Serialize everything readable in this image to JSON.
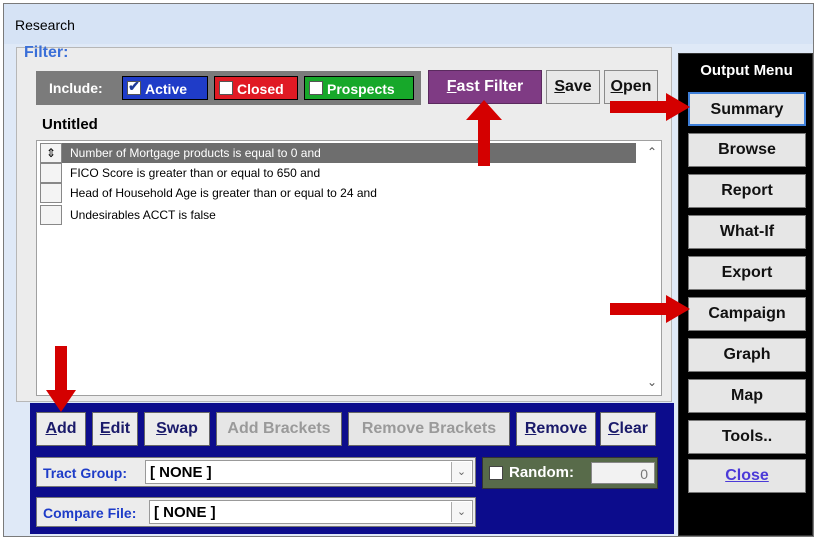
{
  "window": {
    "title": "Research"
  },
  "filter": {
    "label": "Filter:",
    "include_label": "Include:",
    "include_options": [
      {
        "label": "Active",
        "checked": true,
        "color": "#1f3cc8"
      },
      {
        "label": "Closed",
        "checked": false,
        "color": "#e01a24"
      },
      {
        "label": "Prospects",
        "checked": false,
        "color": "#17a82a"
      }
    ],
    "fast_filter_label": "Fast Filter",
    "fast_filter_hotkey": "F",
    "fast_filter_rest": "ast Filter",
    "save_hotkey": "S",
    "save_rest": "ave",
    "open_hotkey": "O",
    "open_rest": "pen",
    "name": "Untitled",
    "conditions": [
      {
        "text": "Number of Mortgage products is equal to 0 and",
        "selected": true
      },
      {
        "text": "FICO Score is greater than or equal to 650 and",
        "selected": false
      },
      {
        "text": "Head of Household Age is greater than or equal to 24 and",
        "selected": false
      },
      {
        "text": "Undesirables ACCT is false",
        "selected": false
      }
    ]
  },
  "actions": {
    "add_hotkey": "A",
    "add_rest": "dd",
    "edit_hotkey": "E",
    "edit_rest": "dit",
    "swap_hotkey": "S",
    "swap_rest": "wap",
    "add_brackets": "Add Brackets",
    "remove_brackets": "Remove Brackets",
    "remove_hotkey": "R",
    "remove_rest": "emove",
    "clear_hotkey": "C",
    "clear_rest": "lear"
  },
  "tract_group": {
    "label": "Tract Group:",
    "value": "[ NONE ]"
  },
  "compare_file": {
    "label": "Compare File:",
    "value": "[ NONE ]"
  },
  "random": {
    "label": "Random:",
    "checked": false,
    "value": "0"
  },
  "output_menu": {
    "title": "Output Menu",
    "items": [
      {
        "label": "Summary"
      },
      {
        "label": "Browse"
      },
      {
        "label": "Report"
      },
      {
        "label": "What-If"
      },
      {
        "label": "Export"
      },
      {
        "label": "Campaign"
      },
      {
        "label": "Graph"
      },
      {
        "label": "Map"
      },
      {
        "label": "Tools.."
      },
      {
        "label": "Close"
      }
    ]
  },
  "colors": {
    "arrow": "#d40000",
    "bottom_panel": "#0c0c8c",
    "fast_filter": "#7f3b84",
    "output_menu_bg": "#000000"
  }
}
